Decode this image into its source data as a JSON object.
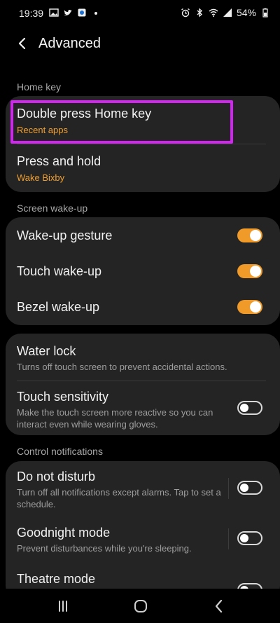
{
  "status_bar": {
    "time": "19:39",
    "battery": "54%",
    "left_icons": [
      "image-icon",
      "twitter-icon",
      "app-icon",
      "dot-icon"
    ],
    "right_icons": [
      "alarm-icon",
      "bluetooth-icon",
      "wifi-icon",
      "signal-icon",
      "battery-icon"
    ]
  },
  "header": {
    "title": "Advanced"
  },
  "sections": {
    "home_key": {
      "label": "Home key"
    },
    "screen_wakeup": {
      "label": "Screen wake-up"
    },
    "control_notifications": {
      "label": "Control notifications"
    }
  },
  "home_key_rows": {
    "double_press": {
      "title": "Double press Home key",
      "value": "Recent apps"
    },
    "press_hold": {
      "title": "Press and hold",
      "value": "Wake Bixby"
    }
  },
  "wakeup_rows": {
    "gesture": {
      "title": "Wake-up gesture",
      "enabled": true
    },
    "touch": {
      "title": "Touch wake-up",
      "enabled": true
    },
    "bezel": {
      "title": "Bezel wake-up",
      "enabled": true
    }
  },
  "misc_rows": {
    "water_lock": {
      "title": "Water lock",
      "subtitle": "Turns off touch screen to prevent accidental actions."
    },
    "touch_sensitivity": {
      "title": "Touch sensitivity",
      "subtitle": "Make the touch screen more reactive so you can interact even while wearing gloves.",
      "enabled": false
    }
  },
  "notif_rows": {
    "dnd": {
      "title": "Do not disturb",
      "subtitle": "Turn off all notifications except alarms. Tap to set a schedule.",
      "enabled": false
    },
    "goodnight": {
      "title": "Goodnight mode",
      "subtitle": "Prevent disturbances while you're sleeping.",
      "enabled": false
    },
    "theatre": {
      "title": "Theatre mode",
      "enabled": false
    }
  },
  "colors": {
    "accent": "#f09a2a",
    "highlight": "#d026f0",
    "card": "#242424",
    "background": "#000000"
  },
  "navbar": {
    "icons": [
      "recents-icon",
      "home-icon",
      "back-icon"
    ]
  }
}
